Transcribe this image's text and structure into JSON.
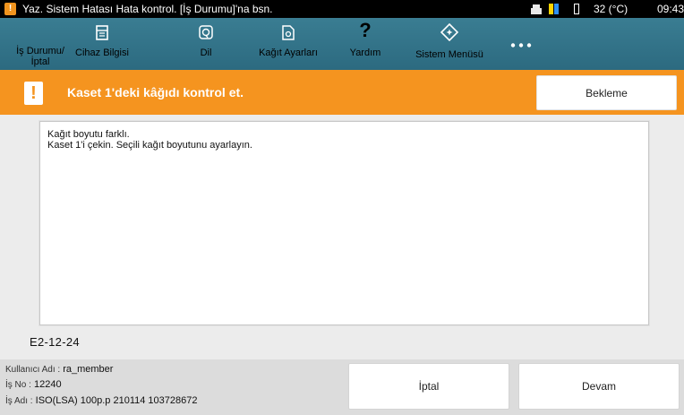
{
  "status_bar": {
    "message": "Yaz. Sistem Hatası Hata kontrol. [İş Durumu]'na bsn.",
    "temperature": "32 (°C)",
    "time": "09:43"
  },
  "toolbar": {
    "items": [
      {
        "label_line1": "İş Durumu/",
        "label_line2": "İptal",
        "icon": "none"
      },
      {
        "label": "Cihaz Bilgisi",
        "icon": "device-info-icon"
      },
      {
        "label": "Dil",
        "icon": "language-icon"
      },
      {
        "label": "Kağıt Ayarları",
        "icon": "paper-settings-icon"
      },
      {
        "label": "Yardım",
        "icon": "help-icon"
      },
      {
        "label": "Sistem Menüsü",
        "icon": "system-menu-icon"
      },
      {
        "label": "",
        "icon": "more-icon"
      }
    ]
  },
  "alert": {
    "title": "Kaset 1'deki kâğıdı kontrol et.",
    "wait_button": "Bekleme"
  },
  "message": {
    "line1": "Kağıt boyutu farklı.",
    "line2": "Kaset 1'i çekin. Seçili kağıt boyutunu ayarlayın."
  },
  "error_code": "E2-12-24",
  "footer": {
    "user_key": "Kullanıcı Adı :",
    "user_value": "ra_member",
    "job_no_key": "İş No :",
    "job_no_value": "12240",
    "job_name_key": "İş Adı :",
    "job_name_value": "ISO(LSA) 100p.p 210114 103728672",
    "cancel_button": "İptal",
    "continue_button": "Devam"
  },
  "colors": {
    "alert": "#f5941f",
    "toolbar": "#2f6f85",
    "status_bar": "#000000"
  }
}
